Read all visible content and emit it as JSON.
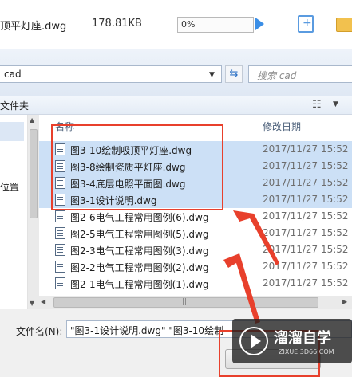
{
  "top": {
    "filename": "顶平灯座.dwg",
    "filesize": "178.81KB",
    "progress_text": "0%",
    "progress": 0
  },
  "nav": {
    "path": "cad",
    "search_placeholder": "搜索 cad"
  },
  "command": {
    "new_folder": "文件夹"
  },
  "left": {
    "location_label": "位置"
  },
  "list": {
    "col_name": "名称",
    "col_date": "修改日期",
    "rows": [
      {
        "name": "图3-10绘制吸顶平灯座.dwg",
        "date": "2017/11/27 15:52",
        "selected": true
      },
      {
        "name": "图3-8绘制瓷质平灯座.dwg",
        "date": "2017/11/27 15:52",
        "selected": true
      },
      {
        "name": "图3-4底层电照平面图.dwg",
        "date": "2017/11/27 15:52",
        "selected": true
      },
      {
        "name": "图3-1设计说明.dwg",
        "date": "2017/11/27 15:52",
        "selected": true
      },
      {
        "name": "图2-6电气工程常用图例(6).dwg",
        "date": "2017/11/27 15:52",
        "selected": false
      },
      {
        "name": "图2-5电气工程常用图例(5).dwg",
        "date": "2017/11/27 15:52",
        "selected": false
      },
      {
        "name": "图2-3电气工程常用图例(3).dwg",
        "date": "2017/11/27 15:52",
        "selected": false
      },
      {
        "name": "图2-2电气工程常用图例(2).dwg",
        "date": "2017/11/27 15:52",
        "selected": false
      },
      {
        "name": "图2-1电气工程常用图例(1).dwg",
        "date": "2017/11/27 15:52",
        "selected": false
      }
    ]
  },
  "bottom": {
    "filename_label": "文件名(N):",
    "filename_value": "\"图3-1设计说明.dwg\" \"图3-10绘制"
  },
  "watermark": {
    "title": "溜溜自学",
    "url": "ZIXUE.3D66.COM"
  },
  "colors": {
    "selection": "#cce0f6",
    "annotation_red": "#e8402c",
    "accent_blue": "#3a8ee6"
  },
  "icons": {
    "play": "play-icon",
    "new_file": "new-file-icon",
    "folder": "folder-icon",
    "refresh": "refresh-icon",
    "view": "view-options-icon",
    "dwg": "dwg-file-icon"
  }
}
